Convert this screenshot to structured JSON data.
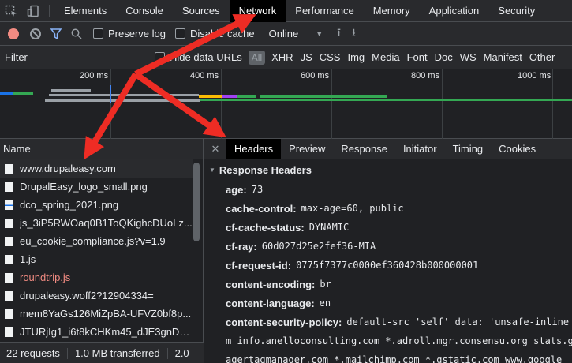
{
  "tabs": [
    "Elements",
    "Console",
    "Sources",
    "Network",
    "Performance",
    "Memory",
    "Application",
    "Security"
  ],
  "toolbar": {
    "preserve_log": "Preserve log",
    "disable_cache": "Disable cache",
    "throttle": "Online"
  },
  "filter": {
    "label": "Filter",
    "hide_data_urls": "Hide data URLs",
    "all": "All",
    "types": [
      "XHR",
      "JS",
      "CSS",
      "Img",
      "Media",
      "Font",
      "Doc",
      "WS",
      "Manifest",
      "Other"
    ]
  },
  "timeline": {
    "ticks": [
      "200 ms",
      "400 ms",
      "600 ms",
      "800 ms",
      "1000 ms"
    ]
  },
  "requests": {
    "header": "Name",
    "items": [
      {
        "name": "www.drupaleasy.com",
        "type": "doc"
      },
      {
        "name": "DrupalEasy_logo_small.png",
        "type": "doc"
      },
      {
        "name": "dco_spring_2021.png",
        "type": "img"
      },
      {
        "name": "js_3iP5RWOaq0B1ToQKighcDUoLz...",
        "type": "doc"
      },
      {
        "name": "eu_cookie_compliance.js?v=1.9",
        "type": "doc"
      },
      {
        "name": "1.js",
        "type": "doc"
      },
      {
        "name": "roundtrip.js",
        "type": "err"
      },
      {
        "name": "drupaleasy.woff2?12904334=",
        "type": "doc"
      },
      {
        "name": "mem8YaGs126MiZpBA-UFVZ0bf8p...",
        "type": "doc"
      },
      {
        "name": "JTURjIg1_i6t8kCHKm45_dJE3gnD_...",
        "type": "doc"
      }
    ]
  },
  "status": {
    "requests": "22 requests",
    "transferred": "1.0 MB transferred",
    "resources": "2.0"
  },
  "details": {
    "tabs": [
      "Headers",
      "Preview",
      "Response",
      "Initiator",
      "Timing",
      "Cookies"
    ],
    "section_title": "Response Headers",
    "headers": [
      {
        "key": "age:",
        "value": "73"
      },
      {
        "key": "cache-control:",
        "value": "max-age=60, public"
      },
      {
        "key": "cf-cache-status:",
        "value": "DYNAMIC"
      },
      {
        "key": "cf-ray:",
        "value": "60d027d25e2fef36-MIA"
      },
      {
        "key": "cf-request-id:",
        "value": "0775f7377c0000ef360428b000000001"
      },
      {
        "key": "content-encoding:",
        "value": "br"
      },
      {
        "key": "content-language:",
        "value": "en"
      },
      {
        "key": "content-security-policy:",
        "value": "default-src 'self' data: 'unsafe-inline"
      }
    ],
    "csp_continuation": "m info.anelloconsulting.com *.adroll.mgr.consensu.org stats.g",
    "csp_continuation2": "agertagmanager.com *.mailchimp.com *.gstatic.com www.google"
  },
  "colors": {
    "annotation_arrow": "#ee2c24",
    "active_tab_bg": "#000000",
    "record": "#f28b82",
    "filter_icon": "#8ab4f8"
  }
}
